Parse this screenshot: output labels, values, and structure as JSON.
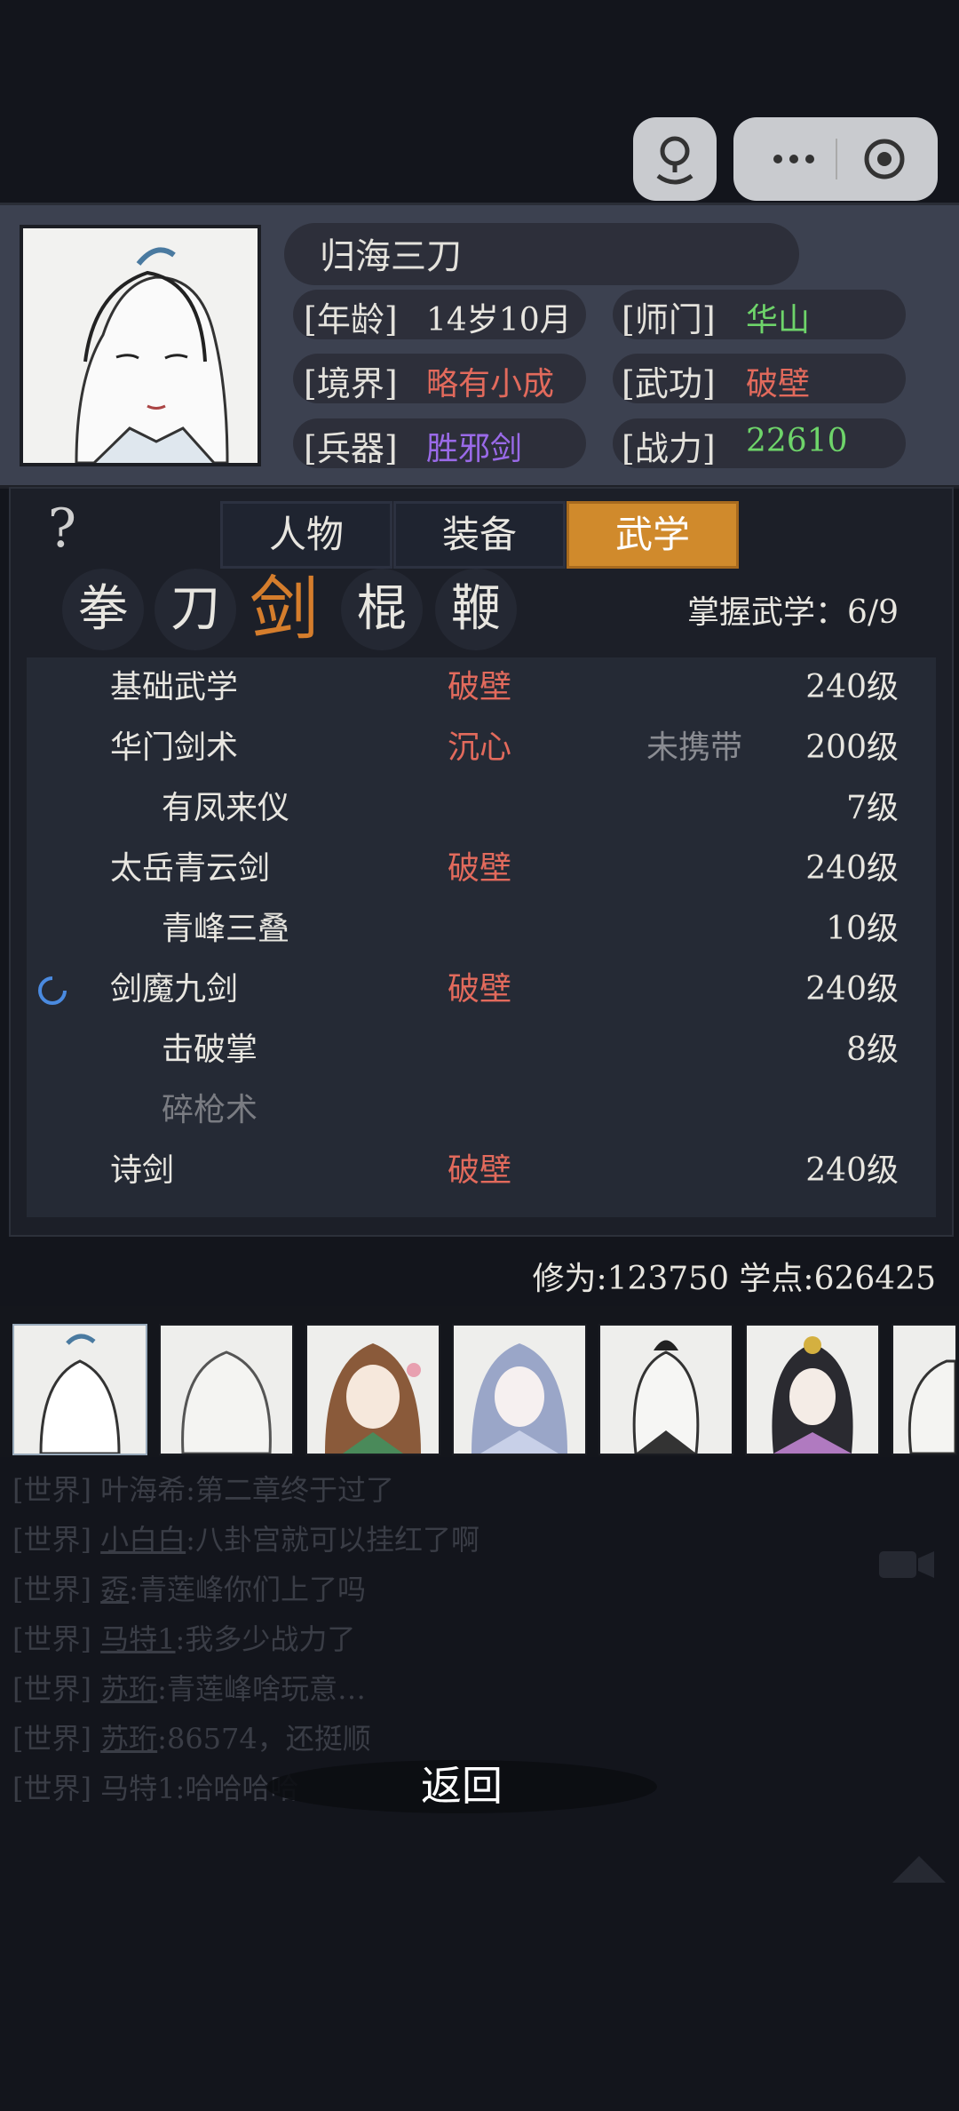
{
  "character": {
    "name": "归海三刀",
    "stats": [
      {
        "label": "[年龄]",
        "value": "14岁10月",
        "color": "#e8e6e0"
      },
      {
        "label": "[师门]",
        "value": "华山",
        "color": "#6ed46a"
      },
      {
        "label": "[境界]",
        "value": "略有小成",
        "color": "#e26a5c"
      },
      {
        "label": "[武功]",
        "value": "破壁",
        "color": "#e26a5c"
      },
      {
        "label": "[兵器]",
        "value": "胜邪剑",
        "color": "#9a6ae8"
      },
      {
        "label": "[战力]",
        "value": "22610",
        "color": "#6ed46a"
      }
    ]
  },
  "help_label": "?",
  "tabs": [
    {
      "label": "人物",
      "active": false
    },
    {
      "label": "装备",
      "active": false
    },
    {
      "label": "武学",
      "active": true
    }
  ],
  "categories": [
    {
      "label": "拳",
      "active": false
    },
    {
      "label": "刀",
      "active": false
    },
    {
      "label": "剑",
      "active": true
    },
    {
      "label": "棍",
      "active": false
    },
    {
      "label": "鞭",
      "active": false
    }
  ],
  "mastery": "掌握武学：6/9",
  "skills": [
    {
      "name": "基础武学",
      "realm": "破壁",
      "carry": "",
      "level": "240级",
      "sub": false,
      "dim": false
    },
    {
      "name": "华门剑术",
      "realm": "沉心",
      "carry": "未携带",
      "level": "200级",
      "sub": false,
      "dim": false
    },
    {
      "name": "有凤来仪",
      "realm": "",
      "carry": "",
      "level": "7级",
      "sub": true,
      "dim": false
    },
    {
      "name": "太岳青云剑",
      "realm": "破壁",
      "carry": "",
      "level": "240级",
      "sub": false,
      "dim": false
    },
    {
      "name": "青峰三叠",
      "realm": "",
      "carry": "",
      "level": "10级",
      "sub": true,
      "dim": false
    },
    {
      "name": "剑魔九剑",
      "realm": "破壁",
      "carry": "",
      "level": "240级",
      "sub": false,
      "dim": false
    },
    {
      "name": "击破掌",
      "realm": "",
      "carry": "",
      "level": "8级",
      "sub": true,
      "dim": false
    },
    {
      "name": "碎枪术",
      "realm": "",
      "carry": "",
      "level": "",
      "sub": true,
      "dim": true
    },
    {
      "name": "诗剑",
      "realm": "破壁",
      "carry": "",
      "level": "240级",
      "sub": false,
      "dim": false
    }
  ],
  "points": "修为:123750  学点:626425",
  "chat": [
    {
      "channel": "[世界]",
      "user": "叶海希",
      "msg": ":第二章终于过了"
    },
    {
      "channel": "[世界]",
      "user": "小白白",
      "msg": ":八卦宫就可以挂红了啊"
    },
    {
      "channel": "[世界]",
      "user": "孬",
      "msg": ":青莲峰你们上了吗"
    },
    {
      "channel": "[世界]",
      "user": "马特1",
      "msg": ":我多少战力了"
    },
    {
      "channel": "[世界]",
      "user": "苏珩",
      "msg": ":青莲峰啥玩意…"
    },
    {
      "channel": "[世界]",
      "user": "苏珩",
      "msg": ":86574，还挺顺"
    },
    {
      "channel": "[世界]",
      "user": "马特1",
      "msg": ":哈哈哈哈"
    }
  ],
  "back_label": "返回",
  "colors": {
    "accent": "#d08a2c",
    "realm_red": "#e26a5c",
    "green": "#6ed46a",
    "purple": "#9a6ae8"
  }
}
